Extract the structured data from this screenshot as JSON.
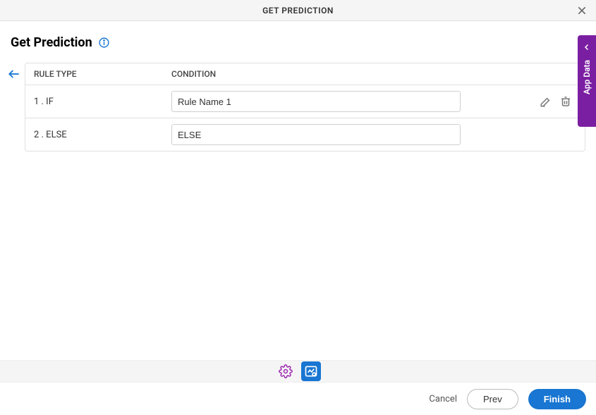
{
  "header": {
    "title": "GET PREDICTION"
  },
  "page": {
    "title": "Get Prediction"
  },
  "table": {
    "columns": {
      "rule_type": "RULE TYPE",
      "condition": "CONDITION"
    },
    "rows": [
      {
        "type": "1 . IF",
        "condition_value": "Rule Name 1",
        "editable": true
      },
      {
        "type": "2 . ELSE",
        "condition_value": "ELSE",
        "editable": false
      }
    ]
  },
  "side_tab": {
    "label": "App Data"
  },
  "footer": {
    "cancel": "Cancel",
    "prev": "Prev",
    "finish": "Finish"
  }
}
